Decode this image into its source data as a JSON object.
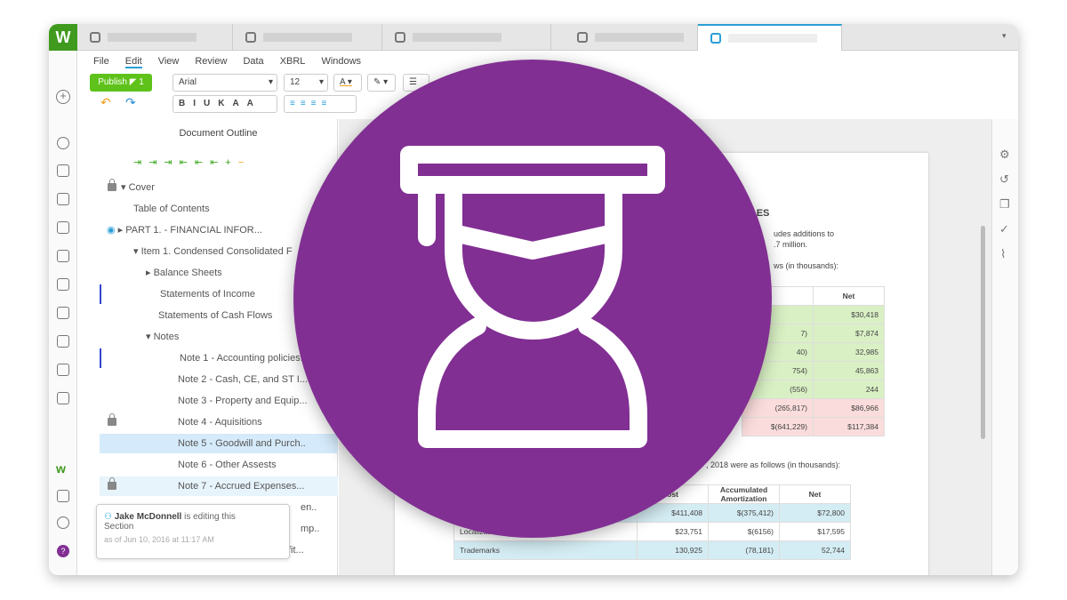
{
  "app": {
    "logo": "W"
  },
  "menu": [
    "File",
    "Edit",
    "View",
    "Review",
    "Data",
    "XBRL",
    "Windows"
  ],
  "toolbar": {
    "publish": "Publish",
    "publish_count": "1",
    "font": "Arial",
    "size": "12"
  },
  "outline": {
    "title": "Document Outline",
    "items": [
      "Cover",
      "Table of Contents",
      "PART 1. - FINANCIAL INFOR...",
      "Item 1. Condensed Consolidated F",
      "Balance Sheets",
      "Statements of Income",
      "Statements of Cash Flows",
      "Notes",
      "Note 1 - Accounting policies...",
      "Note 2 - Cash, CE, and ST I...",
      "Note 3 - Property and Equip...",
      "Note 4 - Aquisitions",
      "Note 5 - Goodwill and Purch..",
      "Note 6 - Other Assests",
      "Note 7 - Accrued Expenses...",
      "en..",
      "mp..",
      "fit..."
    ]
  },
  "tooltip": {
    "user": "Jake McDonnell",
    "action": "is editing this",
    "section": "Section",
    "timestamp": "as of Jun 10, 2016 at 11:17 AM"
  },
  "doc": {
    "heading": "LES",
    "line1": "udes additions to",
    "line2": ".7 million.",
    "line3": "ws (in thousands):",
    "line4": ", 2018 were as follows (in thousands):",
    "table1": {
      "header": "Net",
      "col2": [
        "",
        "7)",
        "40)",
        "754)",
        "(556)",
        "(265,817)",
        "$(641,229)"
      ],
      "net": [
        "$30,418",
        "$7,874",
        "32,985",
        "45,863",
        "244",
        "$86,966",
        "$117,384"
      ]
    },
    "table2": {
      "headers": [
        "ost",
        "Accumulated Amortization",
        "Net"
      ],
      "rows": [
        [
          "",
          "$411,408",
          "$(375,412)",
          "$72,800"
        ],
        [
          "Localization",
          "$23,751",
          "$(6156)",
          "$17,595"
        ],
        [
          "Trademarks",
          "130,925",
          "(78,181)",
          "52,744"
        ]
      ]
    }
  },
  "overlay": {
    "icon": "graduate-student-icon",
    "color": "#812f93"
  }
}
